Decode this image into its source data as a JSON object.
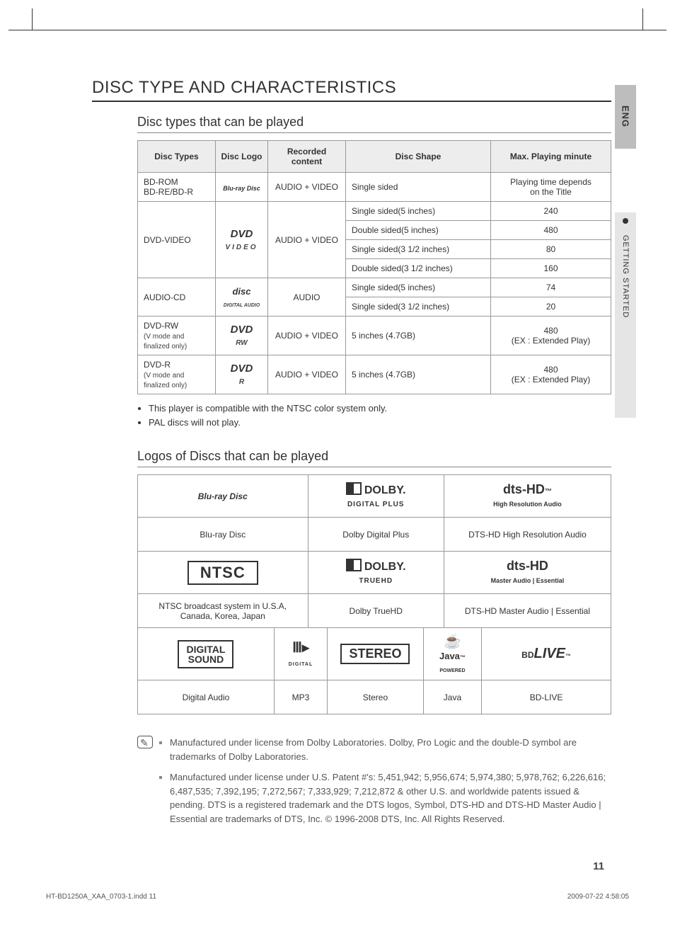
{
  "sideTabEng": "ENG",
  "sideTabSection": "GETTING STARTED",
  "sectionTitle": "DISC TYPE AND CHARACTERISTICS",
  "subTitle1": "Disc types that can be played",
  "tableHeaders": {
    "c1": "Disc Types",
    "c2": "Disc Logo",
    "c3": "Recorded content",
    "c4": "Disc Shape",
    "c5": "Max. Playing minute"
  },
  "row1": {
    "type_a": "BD-ROM",
    "type_b": "BD-RE/BD-R",
    "logo": "Blu-ray Disc",
    "content": "AUDIO + VIDEO",
    "shape": "Single sided",
    "max_a": "Playing time depends",
    "max_b": "on the Title"
  },
  "row2": {
    "type": "DVD-VIDEO",
    "logo": "DVD",
    "logo_sub": "VIDEO",
    "content": "AUDIO + VIDEO",
    "shape1": "Single sided(5 inches)",
    "shape2": "Double sided(5 inches)",
    "shape3": "Single sided(3 1/2 inches)",
    "shape4": "Double sided(3 1/2 inches)",
    "max1": "240",
    "max2": "480",
    "max3": "80",
    "max4": "160"
  },
  "row3": {
    "type": "AUDIO-CD",
    "logo": "disc",
    "logo_sub": "DIGITAL AUDIO",
    "content": "AUDIO",
    "shape1": "Single sided(5 inches)",
    "shape2": "Single sided(3 1/2 inches)",
    "max1": "74",
    "max2": "20"
  },
  "row4": {
    "type_a": "DVD-RW",
    "type_b": "(V mode and finalized only)",
    "logo": "DVD",
    "logo_sub": "RW",
    "content": "AUDIO + VIDEO",
    "shape": "5 inches (4.7GB)",
    "max_a": "480",
    "max_b": "(EX : Extended Play)"
  },
  "row5": {
    "type_a": "DVD-R",
    "type_b": "(V mode and finalized only)",
    "logo": "DVD",
    "logo_sub": "R",
    "content": "AUDIO + VIDEO",
    "shape": "5 inches (4.7GB)",
    "max_a": "480",
    "max_b": "(EX : Extended Play)"
  },
  "bullets": {
    "b1": "This player is compatible with the NTSC color system only.",
    "b2": "PAL discs will not play."
  },
  "subTitle2": "Logos of Discs that can be played",
  "logos": {
    "r1c1_logo": "Blu-ray Disc",
    "r1c2_logo": "DOLBY.",
    "r1c2_sub": "DIGITAL PLUS",
    "r1c3_logo": "dts-HD",
    "r1c3_sub": "High Resolution Audio",
    "r2c1": "Blu-ray Disc",
    "r2c2": "Dolby Digital Plus",
    "r2c3": "DTS-HD High Resolution Audio",
    "r3c1_logo": "NTSC",
    "r3c2_logo": "DOLBY.",
    "r3c2_sub": "TRUEHD",
    "r3c3_logo": "dts-HD",
    "r3c3_sub": "Master Audio | Essential",
    "r4c1_a": "NTSC broadcast system in U.S.A,",
    "r4c1_b": "Canada, Korea, Japan",
    "r4c2": "Dolby TrueHD",
    "r4c3": "DTS-HD Master Audio | Essential",
    "r5c1_a": "DIGITAL",
    "r5c1_b": "SOUND",
    "r5c2_logo": "MP3",
    "r5c3_logo": "STEREO",
    "r5c4_logo": "Java",
    "r5c4_sub": "POWERED",
    "r5c5_logo": "BD LIVE™",
    "r6c1": "Digital Audio",
    "r6c2": "MP3",
    "r6c3": "Stereo",
    "r6c4": "Java",
    "r6c5": "BD-LIVE"
  },
  "notes": {
    "n1": "Manufactured under license from Dolby Laboratories. Dolby, Pro Logic and the double-D symbol are trademarks of Dolby Laboratories.",
    "n2": "Manufactured under license under U.S. Patent #'s: 5,451,942; 5,956,674; 5,974,380; 5,978,762; 6,226,616; 6,487,535; 7,392,195; 7,272,567; 7,333,929; 7,212,872 & other U.S. and worldwide patents issued & pending. DTS is a registered trademark and the DTS logos, Symbol, DTS-HD and DTS-HD Master Audio | Essential are trademarks of DTS, Inc. © 1996-2008 DTS, Inc. All Rights Reserved."
  },
  "pageNum": "11",
  "footerLeft": "HT-BD1250A_XAA_0703-1.indd   11",
  "footerRight": "2009-07-22     4:58:05"
}
